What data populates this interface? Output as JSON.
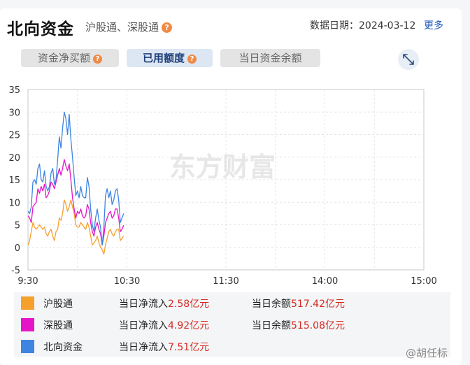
{
  "header": {
    "title": "北向资金",
    "subtitle": "沪股通、深股通",
    "date_label": "数据日期：2024-03-12",
    "more_label": "更多"
  },
  "tabs": [
    {
      "label": "资金净买额",
      "active": false
    },
    {
      "label": "已用额度",
      "active": true
    },
    {
      "label": "当日资金余额",
      "active": false
    }
  ],
  "help_mark": "?",
  "watermark": "东方财富",
  "user_watermark": "@胡任标",
  "chart_data": {
    "type": "line",
    "x_labels": [
      "9:30",
      "10:30",
      "11:30",
      "14:00",
      "15:00"
    ],
    "y_ticks": [
      "35",
      "30",
      "25",
      "20",
      "15",
      "10",
      "5",
      "0",
      "-5"
    ],
    "ylim": [
      -5,
      35
    ],
    "grid": true,
    "x_points_minutes": [
      0,
      1,
      2,
      3,
      4,
      5,
      6,
      7,
      8,
      9,
      10,
      11,
      12,
      13,
      14,
      15,
      16,
      17,
      18,
      19,
      20,
      21,
      22,
      23,
      24,
      25,
      26,
      27,
      28,
      29,
      30,
      31,
      32,
      33,
      34,
      35,
      36,
      37,
      38,
      39,
      40,
      41,
      42,
      43,
      44,
      45,
      46,
      47,
      48,
      49,
      50,
      51,
      52,
      53,
      54,
      55,
      56,
      57,
      58
    ],
    "series": [
      {
        "name": "沪股通",
        "color": "#f5a02a",
        "values": [
          0.5,
          1.5,
          3.5,
          5.5,
          4.5,
          4.0,
          4.5,
          5.0,
          4.5,
          4.0,
          4.5,
          3.0,
          2.5,
          3.5,
          4.0,
          2.5,
          1.5,
          3.5,
          4.0,
          6.5,
          6.0,
          7.5,
          10.5,
          9.5,
          8.0,
          9.0,
          10.5,
          9.0,
          7.5,
          5.0,
          4.5,
          4.5,
          5.5,
          5.0,
          4.5,
          4.0,
          5.5,
          4.5,
          2.5,
          0.5,
          1.0,
          1.5,
          2.5,
          1.0,
          0.0,
          -0.5,
          -1.5,
          0.5,
          2.0,
          3.5,
          4.0,
          3.0,
          2.5,
          3.5,
          4.0,
          4.0,
          1.5,
          2.0,
          2.5
        ]
      },
      {
        "name": "深股通",
        "color": "#e614c8",
        "values": [
          7.0,
          6.5,
          5.5,
          9.0,
          9.5,
          10.0,
          13.0,
          12.0,
          13.5,
          12.5,
          14.0,
          11.0,
          11.5,
          12.5,
          14.5,
          14.0,
          13.0,
          14.5,
          16.0,
          17.5,
          16.0,
          17.5,
          19.5,
          18.0,
          17.0,
          18.5,
          15.0,
          11.0,
          8.5,
          6.5,
          8.0,
          7.5,
          8.5,
          7.0,
          6.5,
          7.0,
          9.5,
          8.5,
          5.5,
          3.5,
          2.5,
          4.5,
          5.5,
          4.0,
          3.0,
          0.5,
          2.5,
          5.5,
          6.5,
          7.5,
          8.0,
          6.5,
          7.0,
          8.5,
          8.5,
          6.5,
          3.5,
          4.0,
          4.9
        ]
      },
      {
        "name": "北向资金",
        "color": "#3d85e0",
        "values": [
          8.0,
          7.5,
          9.0,
          14.5,
          15.0,
          14.0,
          17.5,
          18.5,
          15.0,
          14.5,
          17.0,
          13.5,
          12.5,
          13.5,
          16.5,
          17.5,
          14.0,
          15.0,
          19.5,
          24.5,
          22.0,
          26.5,
          30.0,
          28.5,
          25.0,
          29.5,
          24.0,
          20.0,
          15.5,
          11.5,
          12.5,
          11.0,
          13.5,
          11.5,
          11.0,
          11.0,
          15.5,
          13.5,
          8.5,
          5.0,
          3.5,
          6.5,
          8.5,
          6.0,
          4.5,
          0.5,
          4.5,
          11.5,
          13.0,
          11.0,
          12.5,
          9.5,
          10.5,
          12.5,
          13.0,
          10.5,
          5.5,
          6.5,
          7.51
        ]
      }
    ]
  },
  "legend": [
    {
      "name": "沪股通",
      "color": "#f5a02a",
      "flow_label": "当日净流入",
      "flow_value": "2.58亿元",
      "balance_label": "当日余额",
      "balance_value": "517.42亿元"
    },
    {
      "name": "深股通",
      "color": "#e614c8",
      "flow_label": "当日净流入",
      "flow_value": "4.92亿元",
      "balance_label": "当日余额",
      "balance_value": "515.08亿元"
    },
    {
      "name": "北向资金",
      "color": "#3d85e0",
      "flow_label": "当日净流入",
      "flow_value": "7.51亿元",
      "balance_label": "",
      "balance_value": ""
    }
  ]
}
